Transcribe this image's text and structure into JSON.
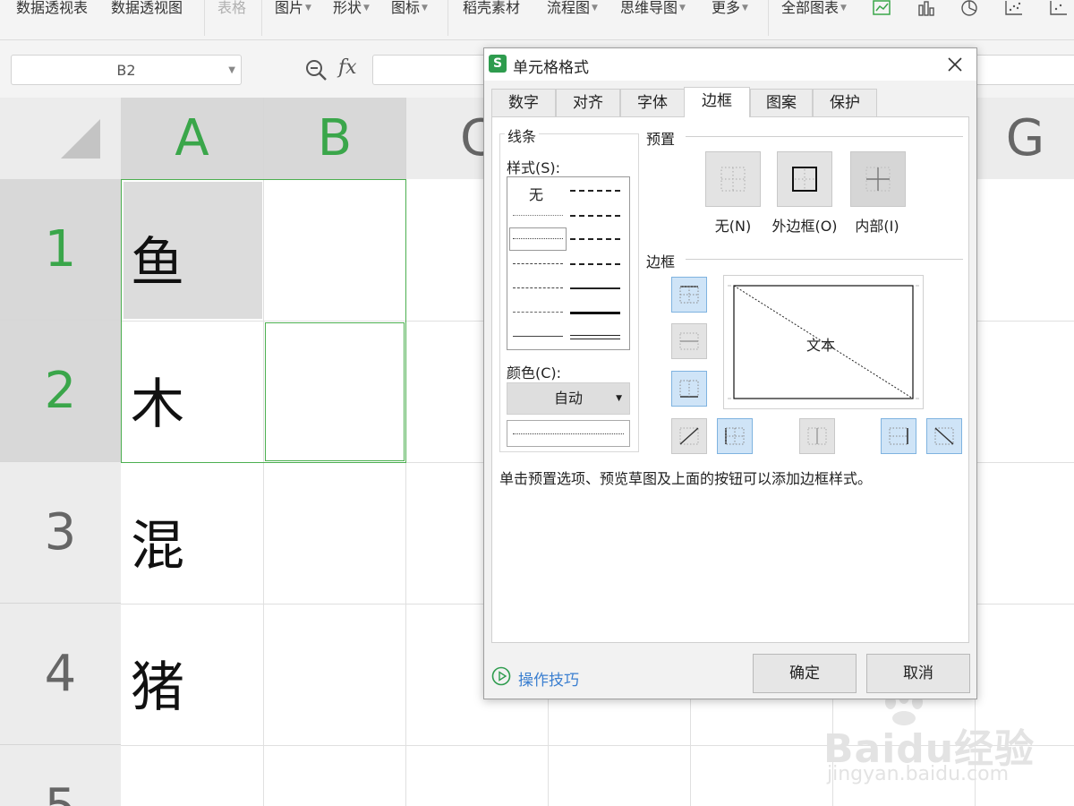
{
  "ribbon": {
    "items": [
      {
        "label": "数据透视表",
        "disabled": false
      },
      {
        "label": "数据透视图",
        "disabled": false
      },
      {
        "label": "表格",
        "disabled": true
      },
      {
        "label": "图片",
        "disabled": false
      },
      {
        "label": "形状",
        "disabled": false
      },
      {
        "label": "图标",
        "disabled": false
      },
      {
        "label": "稻壳素材",
        "disabled": false
      },
      {
        "label": "流程图",
        "disabled": false
      },
      {
        "label": "思维导图",
        "disabled": false
      },
      {
        "label": "更多",
        "disabled": false
      },
      {
        "label": "全部图表",
        "disabled": false
      }
    ]
  },
  "formula_bar": {
    "name_box": "B2",
    "fx_label": "fx",
    "formula": ""
  },
  "sheet": {
    "columns": [
      "A",
      "B",
      "C",
      "G"
    ],
    "rows": [
      "1",
      "2",
      "3",
      "4",
      "5"
    ],
    "cells": {
      "A1": "鱼",
      "A2": "木",
      "A3": "混",
      "A4": "猪"
    },
    "selected_columns": [
      "A",
      "B"
    ],
    "selected_rows": [
      "1",
      "2"
    ],
    "accent_color": "#3aa64a"
  },
  "dialog": {
    "logo": "S",
    "title": "单元格格式",
    "tabs": [
      "数字",
      "对齐",
      "字体",
      "边框",
      "图案",
      "保护"
    ],
    "active_tab": "边框",
    "line_group": {
      "legend": "线条",
      "style_label": "样式(S):",
      "none_label": "无",
      "color_label": "颜色(C):",
      "color_value": "自动"
    },
    "preset_group": {
      "legend": "预置",
      "presets": [
        {
          "label": "无(N)",
          "icon": "border-none-icon"
        },
        {
          "label": "外边框(O)",
          "icon": "border-outline-icon"
        },
        {
          "label": "内部(I)",
          "icon": "border-inside-icon"
        }
      ]
    },
    "border_group": {
      "legend": "边框",
      "preview_text": "文本"
    },
    "hint": "单击预置选项、预览草图及上面的按钮可以添加边框样式。",
    "tips_label": "操作技巧",
    "ok_label": "确定",
    "cancel_label": "取消"
  },
  "watermark": {
    "brand": "Baidu经验",
    "url": "jingyan.baidu.com"
  }
}
